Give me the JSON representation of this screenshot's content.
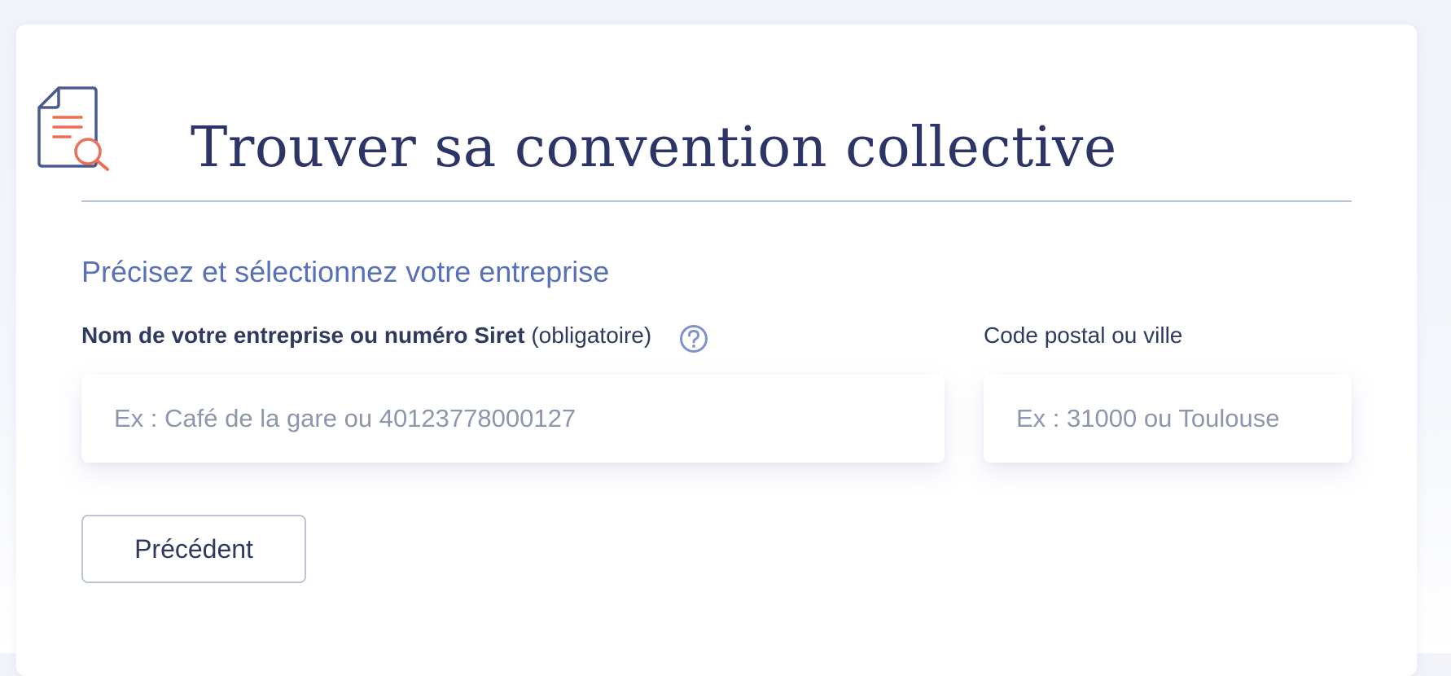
{
  "header": {
    "title": "Trouver sa convention collective",
    "icon": "document-search-icon"
  },
  "section": {
    "heading": "Précisez et sélectionnez votre entreprise"
  },
  "form": {
    "company": {
      "label": "Nom de votre entreprise ou numéro Siret",
      "required_hint": "(obligatoire)",
      "placeholder": "Ex : Café de la gare ou 40123778000127",
      "value": "",
      "help_icon": "question-circle-icon"
    },
    "postal": {
      "label": "Code postal ou ville",
      "placeholder": "Ex : 31000 ou Toulouse",
      "value": ""
    }
  },
  "actions": {
    "previous_label": "Précédent"
  },
  "colors": {
    "title": "#2d3566",
    "accent": "#5870b8",
    "icon_stroke": "#4a5a8c",
    "icon_accent": "#ee6d58",
    "help_icon": "#7f91cf",
    "divider": "#b6c6d4"
  }
}
